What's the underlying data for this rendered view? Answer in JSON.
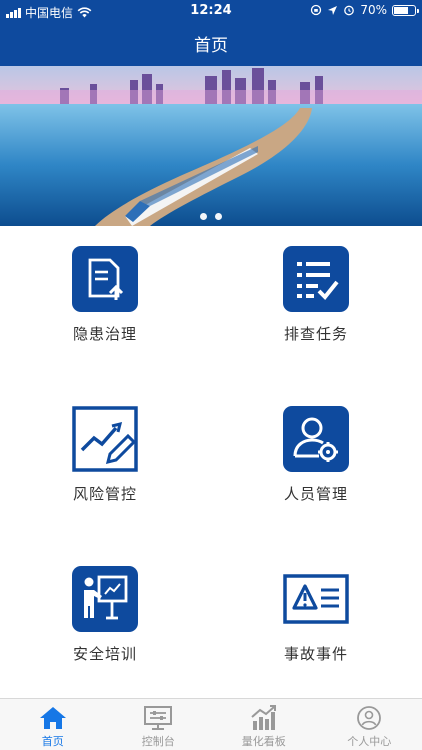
{
  "status": {
    "carrier": "中国电信",
    "time": "12:24",
    "battery": "70%",
    "battery_level": 0.7
  },
  "nav": {
    "title": "首页"
  },
  "banner": {
    "slide_count": 2,
    "active_slide": 0
  },
  "grid": [
    {
      "label": "隐患治理",
      "icon": "document-upload-icon"
    },
    {
      "label": "排查任务",
      "icon": "checklist-icon"
    },
    {
      "label": "风险管控",
      "icon": "chart-edit-icon"
    },
    {
      "label": "人员管理",
      "icon": "user-gear-icon"
    },
    {
      "label": "安全培训",
      "icon": "training-board-icon"
    },
    {
      "label": "事故事件",
      "icon": "warning-card-icon"
    }
  ],
  "tabs": [
    {
      "label": "首页",
      "icon": "home-icon",
      "active": true
    },
    {
      "label": "控制台",
      "icon": "console-icon",
      "active": false
    },
    {
      "label": "量化看板",
      "icon": "bar-chart-icon",
      "active": false
    },
    {
      "label": "个人中心",
      "icon": "user-circle-icon",
      "active": false
    }
  ],
  "colors": {
    "primary": "#0e4a9e",
    "tab_active": "#1677e6",
    "tab_inactive": "#999999"
  }
}
